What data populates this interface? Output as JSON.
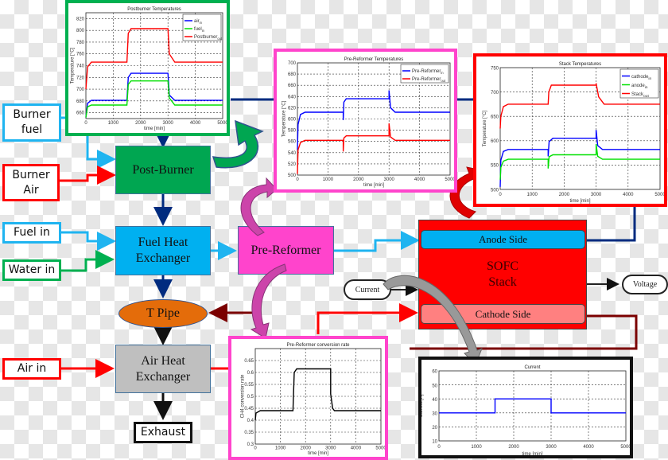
{
  "inputs": {
    "burner_fuel": "Burner fuel",
    "burner_air": "Burner Air",
    "fuel_in": "Fuel in",
    "water_in": "Water in",
    "air_in": "Air in",
    "exhaust": "Exhaust"
  },
  "components": {
    "post_burner": "Post-Burner",
    "fuel_heat_exchanger": "Fuel Heat Exchanger",
    "pre_reformer": "Pre-Reformer",
    "t_pipe": "T Pipe",
    "air_heat_exchanger": "Air Heat Exchanger",
    "sofc_stack": "SOFC Stack",
    "anode_side": "Anode Side",
    "cathode_side": "Cathode Side",
    "current": "Current",
    "voltage": "Voltage"
  },
  "colors": {
    "post_burner": "#00a651",
    "fuel_hx": "#00b0f0",
    "pre_reformer": "#ff44cc",
    "t_pipe": "#e46c0a",
    "air_hx": "#bfbfbf",
    "sofc": "#ff0000",
    "anode": "#00b0f0",
    "cathode": "#ff8080",
    "fuel_line": "#1fb4f0",
    "air_line": "#ff0000",
    "water_line": "#00b050",
    "gas_line": "#002b7f",
    "exhaust_line": "#7b0000"
  },
  "chart_data": [
    {
      "id": "postburner",
      "type": "line",
      "title": "Postburner Temperatures",
      "xlabel": "time [min]",
      "ylabel": "Temperature [°C]",
      "xlim": [
        0,
        5000
      ],
      "ylim": [
        650,
        830
      ],
      "xticks": [
        0,
        1000,
        2000,
        3000,
        4000,
        5000
      ],
      "yticks": [
        660,
        680,
        700,
        720,
        740,
        760,
        780,
        800,
        820
      ],
      "grid": true,
      "legend": "top-right",
      "series": [
        {
          "name": "air_in",
          "label": "air",
          "sub": "in",
          "color": "#0000ff",
          "x": [
            0,
            60,
            200,
            1500,
            1550,
            1650,
            3000,
            3050,
            3250,
            5000
          ],
          "y": [
            652,
            676,
            681,
            681,
            720,
            727,
            727,
            690,
            681,
            681
          ]
        },
        {
          "name": "fuel_in",
          "label": "fuel",
          "sub": "in",
          "color": "#00e000",
          "x": [
            0,
            60,
            200,
            1500,
            1550,
            1650,
            3000,
            3050,
            3250,
            5000
          ],
          "y": [
            652,
            670,
            673,
            673,
            708,
            714,
            714,
            685,
            673,
            673
          ]
        },
        {
          "name": "Postburner_out",
          "label": "Postburner",
          "sub": "out",
          "color": "#ff0000",
          "x": [
            0,
            60,
            200,
            1500,
            1550,
            1650,
            3000,
            3050,
            3250,
            5000
          ],
          "y": [
            700,
            738,
            746,
            746,
            795,
            803,
            803,
            760,
            746,
            746
          ]
        }
      ]
    },
    {
      "id": "prereformer",
      "type": "line",
      "title": "Pre-Reformer Temperatures",
      "xlabel": "time [min]",
      "ylabel": "Temperature [°C]",
      "xlim": [
        0,
        5000
      ],
      "ylim": [
        500,
        700
      ],
      "xticks": [
        0,
        1000,
        2000,
        3000,
        4000,
        5000
      ],
      "yticks": [
        500,
        520,
        540,
        560,
        580,
        600,
        620,
        640,
        660,
        680,
        700
      ],
      "grid": true,
      "legend": "top-right",
      "series": [
        {
          "name": "Pre-Reformer_in",
          "label": "Pre-Reformer",
          "sub": "in",
          "color": "#0000ff",
          "x": [
            0,
            20,
            100,
            250,
            1500,
            1500,
            1520,
            1600,
            3000,
            3000,
            3050,
            3200,
            5000
          ],
          "y": [
            545,
            590,
            608,
            612,
            612,
            598,
            630,
            636,
            636,
            651,
            620,
            612,
            612
          ]
        },
        {
          "name": "Pre-Reformer_out",
          "label": "Pre-Reformer",
          "sub": "out",
          "color": "#ff0000",
          "x": [
            0,
            20,
            100,
            250,
            1500,
            1500,
            1520,
            1600,
            3000,
            3000,
            3050,
            3200,
            5000
          ],
          "y": [
            502,
            545,
            558,
            562,
            562,
            542,
            566,
            570,
            570,
            592,
            568,
            562,
            562
          ]
        }
      ]
    },
    {
      "id": "stack",
      "type": "line",
      "title": "Stack Temperatures",
      "xlabel": "time [min]",
      "ylabel": "Temperature [°C]",
      "xlim": [
        0,
        5000
      ],
      "ylim": [
        500,
        750
      ],
      "xticks": [
        0,
        1000,
        2000,
        3000,
        4000,
        5000
      ],
      "yticks": [
        500,
        550,
        600,
        650,
        700,
        750
      ],
      "grid": true,
      "legend": "top-right",
      "series": [
        {
          "name": "cathode_in",
          "label": "cathode",
          "sub": "in",
          "color": "#0000ff",
          "x": [
            0,
            20,
            100,
            250,
            1500,
            1500,
            1530,
            1650,
            3000,
            3000,
            3050,
            3200,
            5000
          ],
          "y": [
            505,
            560,
            578,
            582,
            582,
            568,
            598,
            605,
            605,
            622,
            590,
            582,
            582
          ]
        },
        {
          "name": "anode_in",
          "label": "anode",
          "sub": "in",
          "color": "#00e000",
          "x": [
            0,
            20,
            100,
            250,
            1500,
            1500,
            1530,
            1650,
            3000,
            3000,
            3050,
            3200,
            5000
          ],
          "y": [
            520,
            545,
            558,
            562,
            562,
            543,
            567,
            571,
            571,
            593,
            568,
            562,
            562
          ]
        },
        {
          "name": "Stack_out",
          "label": "Stack",
          "sub": "out",
          "color": "#ff0000",
          "x": [
            0,
            20,
            100,
            250,
            1500,
            1520,
            1600,
            3000,
            3000,
            3080,
            3250,
            5000
          ],
          "y": [
            625,
            650,
            670,
            675,
            675,
            700,
            714,
            714,
            718,
            690,
            675,
            675
          ]
        }
      ]
    },
    {
      "id": "conversion",
      "type": "line",
      "title": "Pre-Reformer conversion rate",
      "xlabel": "time [min]",
      "ylabel": "CH4 conversion rate",
      "xlim": [
        0,
        5000
      ],
      "ylim": [
        0.3,
        0.7
      ],
      "xticks": [
        0,
        1000,
        2000,
        3000,
        4000,
        5000
      ],
      "yticks": [
        0.3,
        0.35,
        0.4,
        0.45,
        0.5,
        0.55,
        0.6,
        0.65
      ],
      "grid": true,
      "legend": "none",
      "series": [
        {
          "name": "CH4_conversion",
          "color": "#000000",
          "x": [
            0,
            30,
            200,
            1500,
            1550,
            1650,
            2900,
            3000,
            3000,
            3080,
            3150,
            5000
          ],
          "y": [
            0.4,
            0.43,
            0.44,
            0.44,
            0.6,
            0.615,
            0.615,
            0.615,
            0.51,
            0.45,
            0.44,
            0.44
          ]
        }
      ]
    },
    {
      "id": "current",
      "type": "line",
      "title": "Current",
      "xlabel": "time [min]",
      "ylabel": "Current [A]",
      "xlim": [
        0,
        5000
      ],
      "ylim": [
        10,
        60
      ],
      "xticks": [
        0,
        1000,
        2000,
        3000,
        4000,
        5000
      ],
      "yticks": [
        10,
        20,
        30,
        40,
        50,
        60
      ],
      "grid": true,
      "legend": "none",
      "series": [
        {
          "name": "Current",
          "color": "#0000ff",
          "x": [
            0,
            1500,
            1500,
            3000,
            3000,
            5000
          ],
          "y": [
            30,
            30,
            40,
            40,
            30,
            30
          ]
        }
      ]
    }
  ]
}
